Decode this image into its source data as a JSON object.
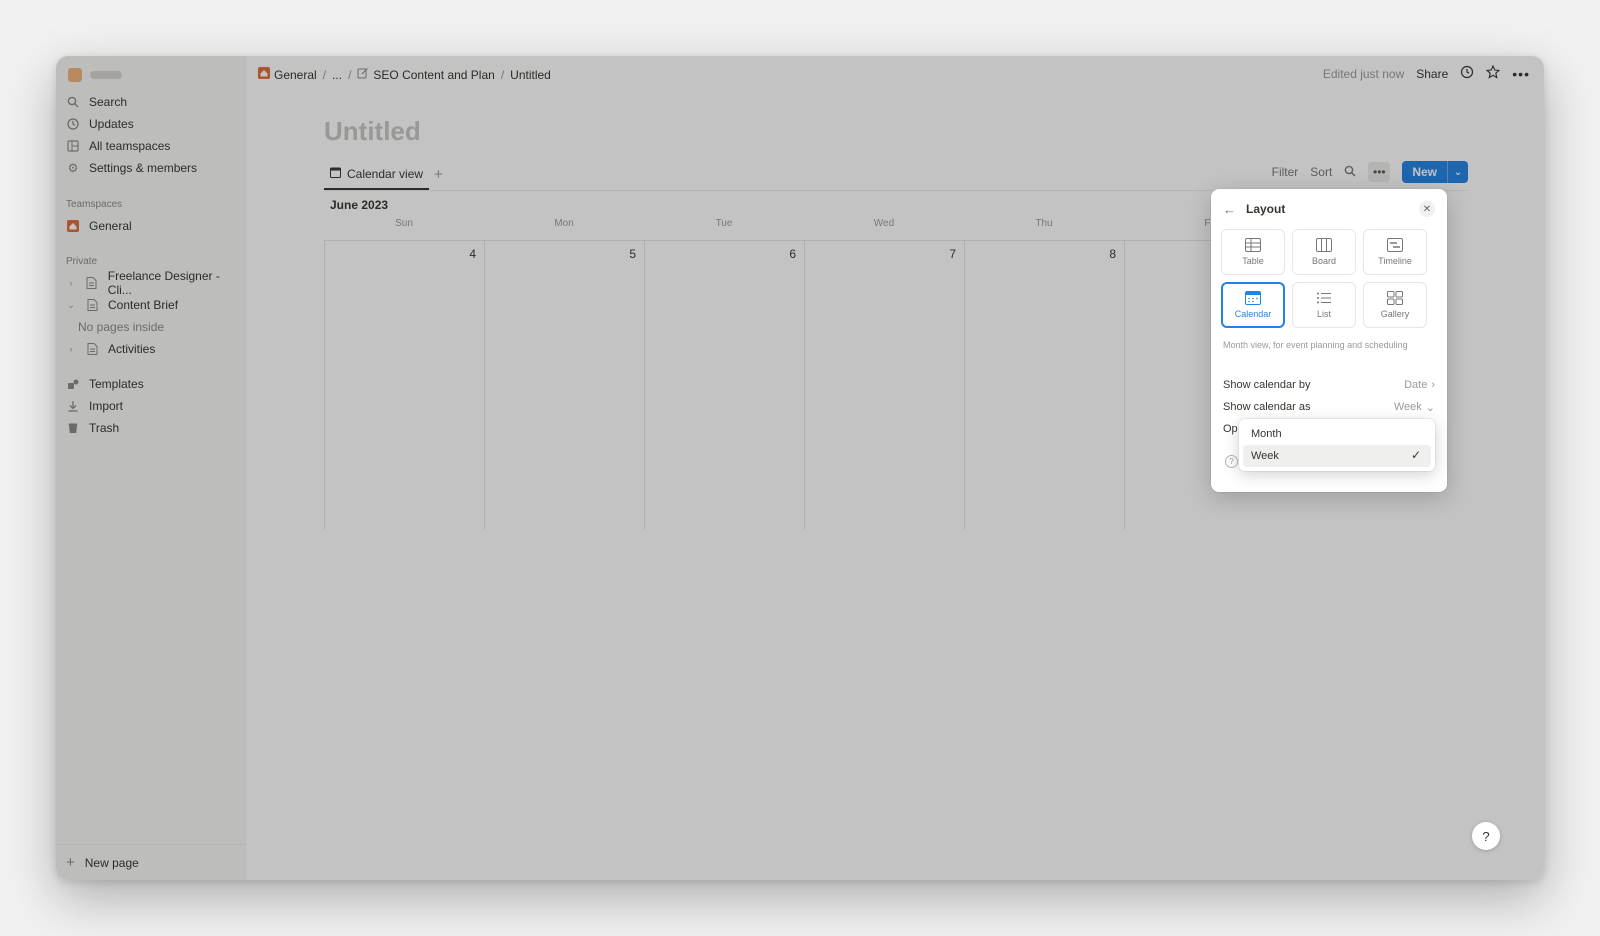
{
  "sidebar": {
    "items": [
      {
        "label": "Search",
        "icon": "search-icon"
      },
      {
        "label": "Updates",
        "icon": "clock-icon"
      },
      {
        "label": "All teamspaces",
        "icon": "grid-icon"
      },
      {
        "label": "Settings & members",
        "icon": "gear-icon"
      }
    ],
    "teamspaces_heading": "Teamspaces",
    "teamspace_item": "General",
    "private_heading": "Private",
    "pages": [
      {
        "label": "Freelance Designer - Cli..."
      },
      {
        "label": "Content Brief"
      },
      {
        "label": "Activities"
      }
    ],
    "empty_child": "No pages inside",
    "bottom_items": [
      {
        "label": "Templates"
      },
      {
        "label": "Import"
      },
      {
        "label": "Trash"
      }
    ],
    "new_page": "New page"
  },
  "breadcrumb": {
    "home": "General",
    "ellipsis": "...",
    "parent": "SEO Content and Plan",
    "current": "Untitled"
  },
  "topbar": {
    "edited": "Edited just now",
    "share": "Share"
  },
  "page": {
    "title": "Untitled",
    "view_tab": "Calendar view"
  },
  "toolbar": {
    "filter": "Filter",
    "sort": "Sort",
    "new": "New"
  },
  "calendar": {
    "month": "June 2023",
    "days": [
      {
        "dow": "Sun",
        "num": "4"
      },
      {
        "dow": "Mon",
        "num": "5"
      },
      {
        "dow": "Tue",
        "num": "6"
      },
      {
        "dow": "Wed",
        "num": "7"
      },
      {
        "dow": "Thu",
        "num": "8"
      },
      {
        "dow": "Fri",
        "num": ""
      }
    ]
  },
  "layout_panel": {
    "title": "Layout",
    "options": [
      "Table",
      "Board",
      "Timeline",
      "Calendar",
      "List",
      "Gallery"
    ],
    "selected": "Calendar",
    "description": "Month view, for event planning and scheduling",
    "show_by_label": "Show calendar by",
    "show_by_value": "Date",
    "show_as_label": "Show calendar as",
    "show_as_value": "Week",
    "truncated_label": "Op"
  },
  "dropdown": {
    "options": [
      "Month",
      "Week"
    ],
    "selected": "Week"
  },
  "colors": {
    "accent": "#2383e2",
    "home_icon": "#e16a3a"
  }
}
